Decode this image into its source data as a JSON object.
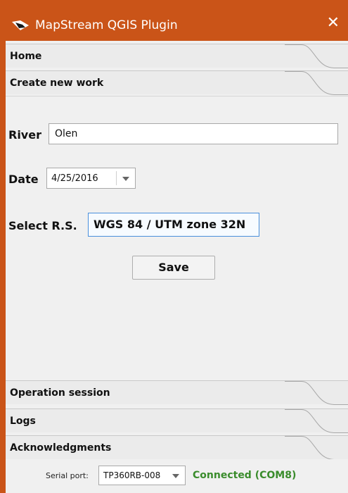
{
  "window": {
    "title": "MapStream QGIS Plugin",
    "close_symbol": "✕",
    "app_icon": "mapstream-logo-icon",
    "accent_color": "#ca5418"
  },
  "sections": {
    "home": "Home",
    "create_new_work": "Create new work",
    "operation_session": "Operation session",
    "logs": "Logs",
    "acknowledgments": "Acknowledgments"
  },
  "form": {
    "river_label": "River",
    "river_value": "Olen",
    "date_label": "Date",
    "date_value": "4/25/2016",
    "rs_label": "Select R.S.",
    "rs_value": "WGS 84 / UTM zone 32N",
    "save_label": "Save"
  },
  "status": {
    "serial_port_label": "Serial port:",
    "serial_port_value": "TP360RB-008",
    "connection_text": "Connected (COM8)",
    "connection_color": "#3a8c2c"
  }
}
